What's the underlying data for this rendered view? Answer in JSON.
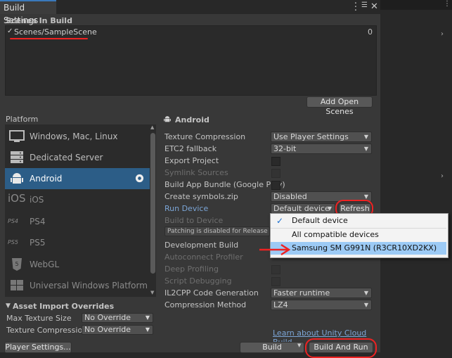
{
  "window": {
    "title": "Build Settings"
  },
  "scenes": {
    "header": "Scenes In Build",
    "items": [
      {
        "checked_mark": "✓",
        "name": "Scenes/SampleScene",
        "index": "0"
      }
    ],
    "add_open_scenes": "Add Open Scenes"
  },
  "platform": {
    "header": "Platform",
    "items": [
      {
        "label": "Windows, Mac, Linux",
        "icon": "monitor-icon"
      },
      {
        "label": "Dedicated Server",
        "icon": "server-icon"
      },
      {
        "label": "Android",
        "icon": "android-icon"
      },
      {
        "label": "iOS",
        "icon": "ios-icon"
      },
      {
        "label": "PS4",
        "icon": "ps4-icon"
      },
      {
        "label": "PS5",
        "icon": "ps5-icon"
      },
      {
        "label": "WebGL",
        "icon": "html5-icon"
      },
      {
        "label": "Universal Windows Platform",
        "icon": "windows-icon"
      }
    ]
  },
  "asset_import": {
    "header": "Asset Import Overrides",
    "max_texture_label": "Max Texture Size",
    "max_texture_value": "No Override",
    "compression_label": "Texture Compression",
    "compression_value": "No Override"
  },
  "android": {
    "header": "Android",
    "texture_compression": {
      "label": "Texture Compression",
      "value": "Use Player Settings"
    },
    "etc2_fallback": {
      "label": "ETC2 fallback",
      "value": "32-bit"
    },
    "export_project": "Export Project",
    "symlink_sources": "Symlink Sources",
    "build_app_bundle": "Build App Bundle (Google Play)",
    "create_symbols": {
      "label": "Create symbols.zip",
      "value": "Disabled"
    },
    "run_device": {
      "label": "Run Device",
      "value": "Default device",
      "refresh": "Refresh"
    },
    "build_to_device": "Build to Device",
    "patching_note": "Patching is disabled for Release build",
    "development_build": "Development Build",
    "autoconnect_profiler": "Autoconnect Profiler",
    "deep_profiling": "Deep Profiling",
    "script_debugging": "Script Debugging",
    "il2cpp": {
      "label": "IL2CPP Code Generation",
      "value": "Faster runtime"
    },
    "compression": {
      "label": "Compression Method",
      "value": "LZ4"
    },
    "cloud_link": "Learn about Unity Cloud Build"
  },
  "device_popup": {
    "checked_mark": "✓",
    "items": [
      "Default device",
      "All compatible devices",
      "Samsung SM G991N (R3CR10XD2KX)"
    ]
  },
  "footer": {
    "player_settings": "Player Settings...",
    "build": "Build",
    "build_and_run": "Build And Run"
  },
  "colors": {
    "annotation_red": "#ee2222",
    "selection_blue": "#2c5d87",
    "popup_highlight": "#9ccaf5"
  }
}
